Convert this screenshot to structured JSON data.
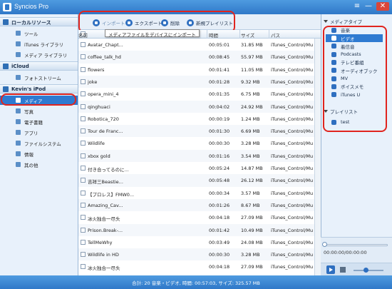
{
  "app": {
    "title": "Syncios Pro"
  },
  "window": {
    "menu": "≡",
    "minimize": "—",
    "close": "✕"
  },
  "sidebar": {
    "local_section": "ローカルリソース",
    "local_items": [
      {
        "label": "ツール",
        "icon": "tools-icon"
      },
      {
        "label": "iTunes ライブラリ",
        "icon": "itunes-library-icon"
      },
      {
        "label": "メディア ライブラリ",
        "icon": "media-library-icon"
      }
    ],
    "icloud_section": "iCloud",
    "icloud_items": [
      {
        "label": "フォトストリーム",
        "icon": "photostream-icon"
      }
    ],
    "device_section": "Kevin's iPod",
    "device_items": [
      {
        "label": "メディア",
        "icon": "media-icon",
        "selected": true
      },
      {
        "label": "写真",
        "icon": "photo-icon"
      },
      {
        "label": "電子書籍",
        "icon": "ebook-icon"
      },
      {
        "label": "アプリ",
        "icon": "app-icon"
      },
      {
        "label": "ファイルシステム",
        "icon": "filesystem-icon"
      },
      {
        "label": "情報",
        "icon": "info-icon"
      },
      {
        "label": "其の他",
        "icon": "other-icon"
      }
    ]
  },
  "toolbar": {
    "import": "インポート",
    "export": "エクスポート",
    "delete": "削除",
    "new_playlist": "新規プレイリスト",
    "tooltip": "メディアファイルをデバイスにインポート"
  },
  "table": {
    "columns": {
      "name": "名前",
      "time": "時間",
      "size": "サイズ",
      "path": "パス"
    },
    "rows": [
      {
        "name": "Avatar_Chapt...",
        "time": "00:05:01",
        "size": "31.85 MB",
        "path": "iTunes_Control/Mu"
      },
      {
        "name": "coffee_talk_hd",
        "time": "00:08:45",
        "size": "55.97 MB",
        "path": "iTunes_Control/Mu"
      },
      {
        "name": "flowers",
        "time": "00:01:41",
        "size": "11.05 MB",
        "path": "iTunes_Control/Mu"
      },
      {
        "name": "joke",
        "time": "00:01:28",
        "size": "9.32 MB",
        "path": "iTunes_Control/Mu"
      },
      {
        "name": "opera_mini_4",
        "time": "00:01:35",
        "size": "6.75 MB",
        "path": "iTunes_Control/Mu"
      },
      {
        "name": "qinghuaci",
        "time": "00:04:02",
        "size": "24.92 MB",
        "path": "iTunes_Control/Mu"
      },
      {
        "name": "Robotica_720",
        "time": "00:00:19",
        "size": "1.24 MB",
        "path": "iTunes_Control/Mu"
      },
      {
        "name": "Tour de Franc...",
        "time": "00:01:30",
        "size": "6.69 MB",
        "path": "iTunes_Control/Mu"
      },
      {
        "name": "Wildlife",
        "time": "00:00:30",
        "size": "3.28 MB",
        "path": "iTunes_Control/Mu"
      },
      {
        "name": "xbox gold",
        "time": "00:01:16",
        "size": "3.54 MB",
        "path": "iTunes_Control/Mu"
      },
      {
        "name": "付き合ってるのに...",
        "time": "00:05:24",
        "size": "14.87 MB",
        "path": "iTunes_Control/Mu"
      },
      {
        "name": "吉祥三Beastie...",
        "time": "00:05:48",
        "size": "26.12 MB",
        "path": "iTunes_Control/Mu"
      },
      {
        "name": "【プロレス】FMW0...",
        "time": "00:00:34",
        "size": "3.57 MB",
        "path": "iTunes_Control/Mu"
      },
      {
        "name": "Amazing_Cav...",
        "time": "00:01:26",
        "size": "8.67 MB",
        "path": "iTunes_Control/Mu"
      },
      {
        "name": "冰火独合一尽头",
        "time": "00:04:18",
        "size": "27.09 MB",
        "path": "iTunes_Control/Mu"
      },
      {
        "name": "Prison.Break-...",
        "time": "00:01:42",
        "size": "10.49 MB",
        "path": "iTunes_Control/Mu"
      },
      {
        "name": "TellMeWhy",
        "time": "00:03:49",
        "size": "24.08 MB",
        "path": "iTunes_Control/Mu"
      },
      {
        "name": "Wildlife in HD",
        "time": "00:00:30",
        "size": "3.28 MB",
        "path": "iTunes_Control/Mu"
      },
      {
        "name": "冰火独合一尽头",
        "time": "00:04:18",
        "size": "27.09 MB",
        "path": "iTunes_Control/Mu"
      }
    ]
  },
  "right_panel": {
    "media_type_header": "メディアタイプ",
    "media_types": [
      {
        "label": "音楽",
        "icon": "music-icon"
      },
      {
        "label": "ビデオ",
        "icon": "video-icon",
        "selected": true
      },
      {
        "label": "着信音",
        "icon": "ringtone-icon"
      },
      {
        "label": "Podcasts",
        "icon": "podcast-icon"
      },
      {
        "label": "テレビ番組",
        "icon": "tv-icon"
      },
      {
        "label": "オーディオブック",
        "icon": "audiobook-icon"
      },
      {
        "label": "MV",
        "icon": "mv-icon"
      },
      {
        "label": "ボイスメモ",
        "icon": "voice-memo-icon"
      },
      {
        "label": "iTunes U",
        "icon": "itunes-u-icon"
      }
    ],
    "playlist_header": "プレイリスト",
    "playlists": [
      {
        "label": "test",
        "icon": "playlist-icon"
      }
    ]
  },
  "player": {
    "time": "00:00:00/00:00:00",
    "progress": 0,
    "volume": 0.4
  },
  "status": {
    "text": "合計: 20 音楽・ビデオ, 時間: 00:57:03, サイズ: 325.57 MB"
  },
  "colors": {
    "accent": "#2e7ad1",
    "highlight": "#e0241e",
    "titlebar": "#3a86d4"
  }
}
